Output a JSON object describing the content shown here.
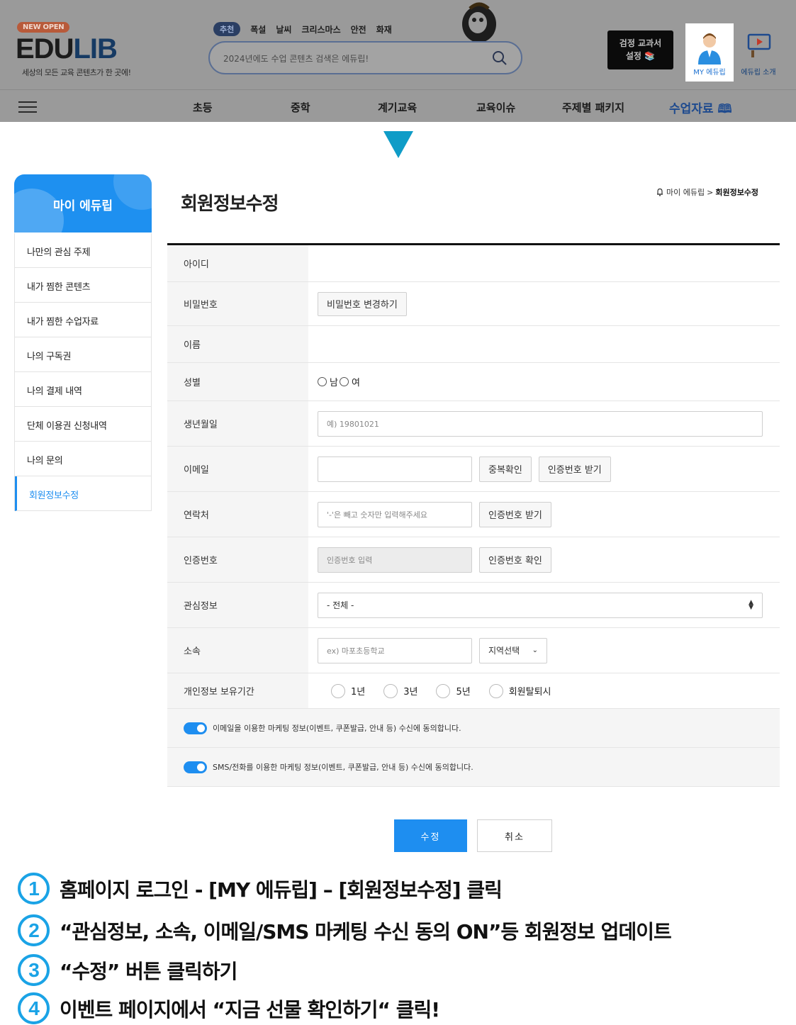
{
  "header": {
    "badge": "NEW OPEN",
    "logo_edu": "EDU",
    "logo_lib": "LIB",
    "tagline": "세상의 모든 교육 콘텐츠가 한 곳에!",
    "keyword_tag": "추천",
    "keywords": [
      "폭설",
      "날씨",
      "크리스마스",
      "안전",
      "화재"
    ],
    "search_placeholder": "2024년에도 수업 콘텐츠 검색은 에듀립!",
    "textbook_line1": "검정 교과서",
    "textbook_line2": "설정",
    "my_label": "MY 에듀립",
    "intro_label": "에듀립 소개"
  },
  "nav": {
    "items": [
      "초등",
      "중학",
      "계기교육",
      "교육이슈",
      "주제별 패키지"
    ],
    "highlight": "수업자료"
  },
  "sidebar": {
    "title": "마이 에듀립",
    "items": [
      {
        "label": "나만의 관심 주제"
      },
      {
        "label": "내가 찜한 콘텐츠"
      },
      {
        "label": "내가 찜한 수업자료"
      },
      {
        "label": "나의 구독권"
      },
      {
        "label": "나의 결제 내역"
      },
      {
        "label": "단체 이용권 신청내역"
      },
      {
        "label": "나의 문의"
      },
      {
        "label": "회원정보수정"
      }
    ],
    "active_index": 7
  },
  "page": {
    "title": "회원정보수정",
    "crumb_home": "마이 에듀립",
    "crumb_sep": ">",
    "crumb_current": "회원정보수정"
  },
  "form": {
    "id_label": "아이디",
    "pw_label": "비밀번호",
    "pw_button": "비밀번호 변경하기",
    "name_label": "이름",
    "gender_label": "성별",
    "gender_male": "남",
    "gender_female": "여",
    "birth_label": "생년월일",
    "birth_placeholder": "예) 19801021",
    "email_label": "이메일",
    "email_dup_button": "중복확인",
    "email_auth_button": "인증번호 받기",
    "phone_label": "연락처",
    "phone_placeholder": "'-'은 빼고 숫자만 입력해주세요",
    "phone_auth_button": "인증번호 받기",
    "auth_label": "인증번호",
    "auth_placeholder": "인증번호 입력",
    "auth_confirm_button": "인증번호 확인",
    "interest_label": "관심정보",
    "interest_value": "- 전체 -",
    "org_label": "소속",
    "org_placeholder": "ex) 마포초등학교",
    "region_value": "지역선택",
    "retention_label": "개인정보 보유기간",
    "retention_options": [
      "1년",
      "3년",
      "5년",
      "회원탈퇴시"
    ],
    "agree_email": "이메일을 이용한 마케팅 정보(이벤트, 쿠폰발급, 안내 등) 수신에 동의합니다.",
    "agree_sms": "SMS/전화를 이용한 마케팅 정보(이벤트, 쿠폰발급, 안내 등) 수신에 동의합니다.",
    "submit": "수정",
    "cancel": "취소"
  },
  "steps": [
    {
      "num": "1",
      "text": "홈페이지 로그인 -  [MY 에듀립] – [회원정보수정] 클릭"
    },
    {
      "num": "2",
      "text": "“관심정보, 소속, 이메일/SMS 마케팅 수신 동의 ON”등 회원정보 업데이트"
    },
    {
      "num": "3",
      "text": "“수정” 버튼 클릭하기"
    },
    {
      "num": "4",
      "text": "이벤트 페이지에서 “지금 선물 확인하기“ 클릭!"
    }
  ],
  "colors": {
    "accent": "#1e8ef0",
    "arrow": "#0f9cc7",
    "step_circle": "#1aa3e6",
    "header_dim": "#9a9a9a"
  }
}
